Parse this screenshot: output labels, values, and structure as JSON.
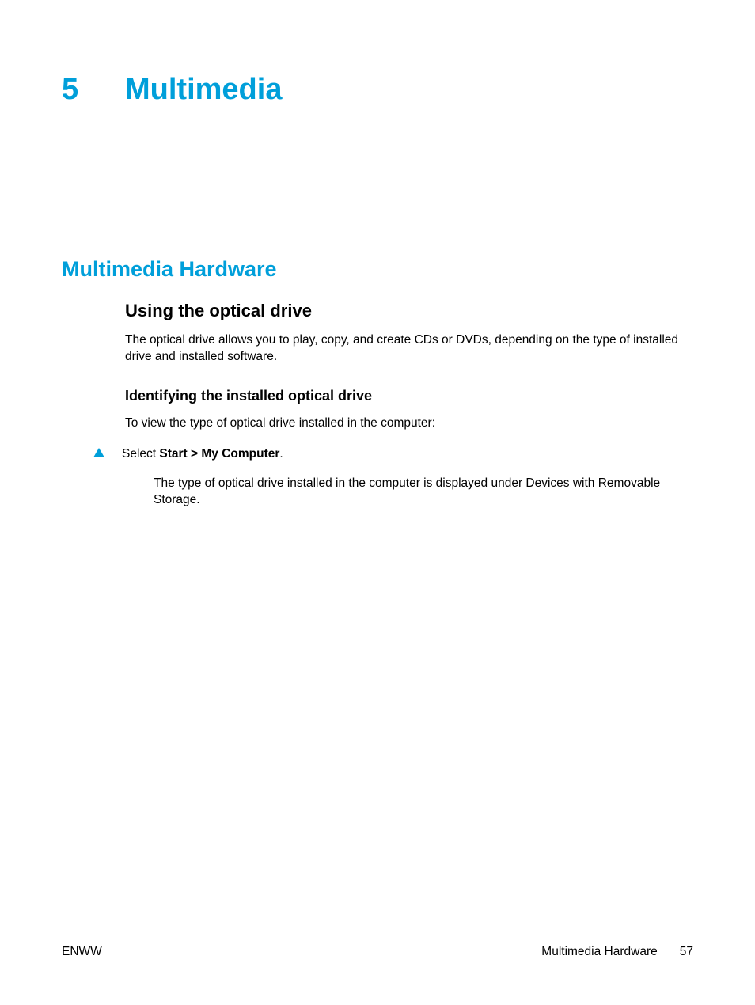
{
  "chapter": {
    "number": "5",
    "title": "Multimedia"
  },
  "section": {
    "heading": "Multimedia Hardware"
  },
  "subsection": {
    "heading": "Using the optical drive",
    "body": "The optical drive allows you to play, copy, and create CDs or DVDs, depending on the type of installed drive and installed software."
  },
  "subsubsection": {
    "heading": "Identifying the installed optical drive",
    "body": "To view the type of optical drive installed in the computer:"
  },
  "step": {
    "prefix": "Select ",
    "bold": "Start > My Computer",
    "suffix": ".",
    "detail": "The type of optical drive installed in the computer is displayed under Devices with Removable Storage."
  },
  "footer": {
    "left": "ENWW",
    "section": "Multimedia Hardware",
    "page": "57"
  }
}
